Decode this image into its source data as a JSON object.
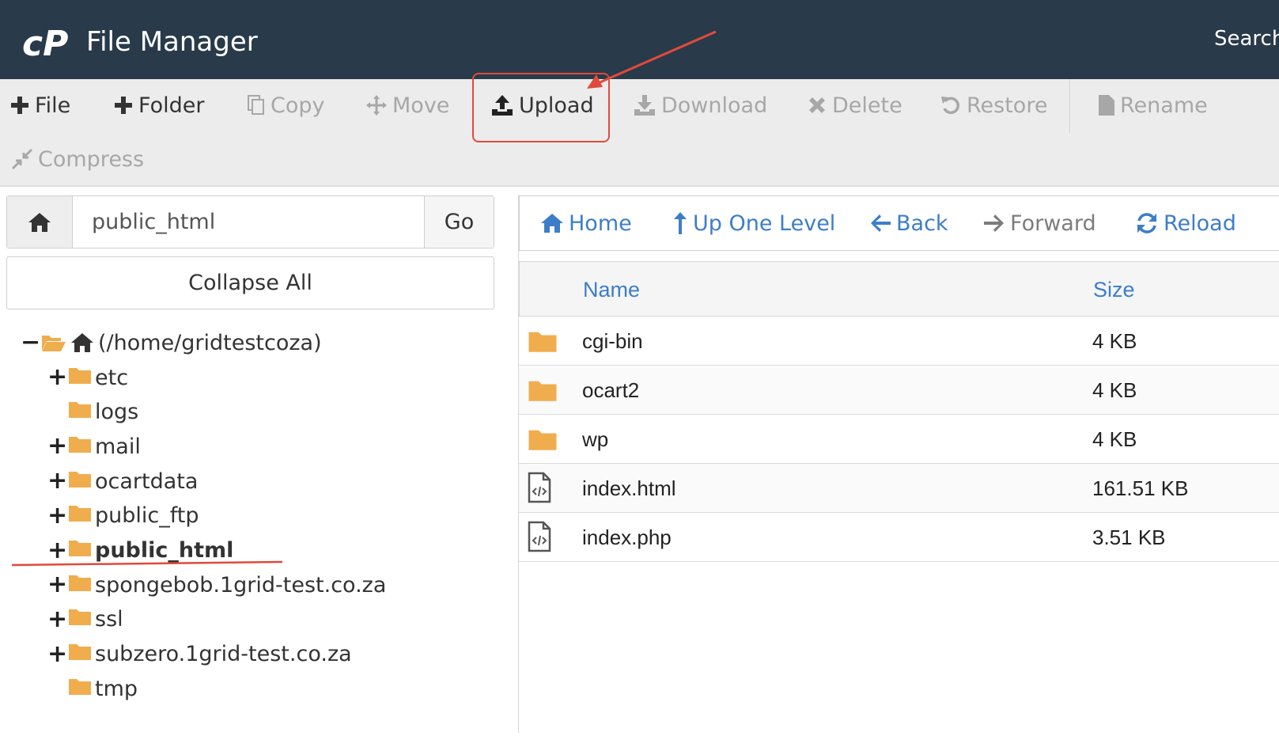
{
  "header": {
    "title": "File Manager",
    "search_label": "Search"
  },
  "toolbar": {
    "items": [
      {
        "label": "File",
        "icon": "plus-icon",
        "enabled": true
      },
      {
        "label": "Folder",
        "icon": "plus-icon",
        "enabled": true
      },
      {
        "label": "Copy",
        "icon": "copy-icon",
        "enabled": false
      },
      {
        "label": "Move",
        "icon": "move-icon",
        "enabled": false
      },
      {
        "label": "Upload",
        "icon": "upload-icon",
        "enabled": true,
        "highlighted": true
      },
      {
        "label": "Download",
        "icon": "download-icon",
        "enabled": false
      },
      {
        "label": "Delete",
        "icon": "x-icon",
        "enabled": false
      },
      {
        "label": "Restore",
        "icon": "restore-icon",
        "enabled": false
      },
      {
        "label": "Rename",
        "icon": "file-icon",
        "enabled": false
      },
      {
        "label": "Compress",
        "icon": "compress-icon",
        "enabled": false
      }
    ]
  },
  "path_bar": {
    "value": "public_html",
    "go_label": "Go"
  },
  "collapse_label": "Collapse All",
  "tree": {
    "root": "(/home/gridtestcoza)",
    "items": [
      {
        "label": "etc",
        "expandable": true
      },
      {
        "label": "logs",
        "expandable": false
      },
      {
        "label": "mail",
        "expandable": true
      },
      {
        "label": "ocartdata",
        "expandable": true
      },
      {
        "label": "public_ftp",
        "expandable": true
      },
      {
        "label": "public_html",
        "expandable": true,
        "active": true
      },
      {
        "label": "spongebob.1grid-test.co.za",
        "expandable": true
      },
      {
        "label": "ssl",
        "expandable": true
      },
      {
        "label": "subzero.1grid-test.co.za",
        "expandable": true
      },
      {
        "label": "tmp",
        "expandable": false
      }
    ]
  },
  "nav": {
    "items": [
      {
        "label": "Home",
        "icon": "home-icon",
        "enabled": true
      },
      {
        "label": "Up One Level",
        "icon": "up-arrow-icon",
        "enabled": true
      },
      {
        "label": "Back",
        "icon": "left-arrow-icon",
        "enabled": true
      },
      {
        "label": "Forward",
        "icon": "right-arrow-icon",
        "enabled": false
      },
      {
        "label": "Reload",
        "icon": "reload-icon",
        "enabled": true
      }
    ]
  },
  "table": {
    "columns": [
      "Name",
      "Size"
    ],
    "rows": [
      {
        "name": "cgi-bin",
        "size": "4 KB",
        "type": "folder"
      },
      {
        "name": "ocart2",
        "size": "4 KB",
        "type": "folder"
      },
      {
        "name": "wp",
        "size": "4 KB",
        "type": "folder"
      },
      {
        "name": "index.html",
        "size": "161.51 KB",
        "type": "code"
      },
      {
        "name": "index.php",
        "size": "3.51 KB",
        "type": "code"
      }
    ]
  },
  "colors": {
    "header_bg": "#293a4a",
    "link_blue": "#3d7dc8",
    "folder": "#f0ad4e",
    "annotation_red": "#e04a3c"
  }
}
